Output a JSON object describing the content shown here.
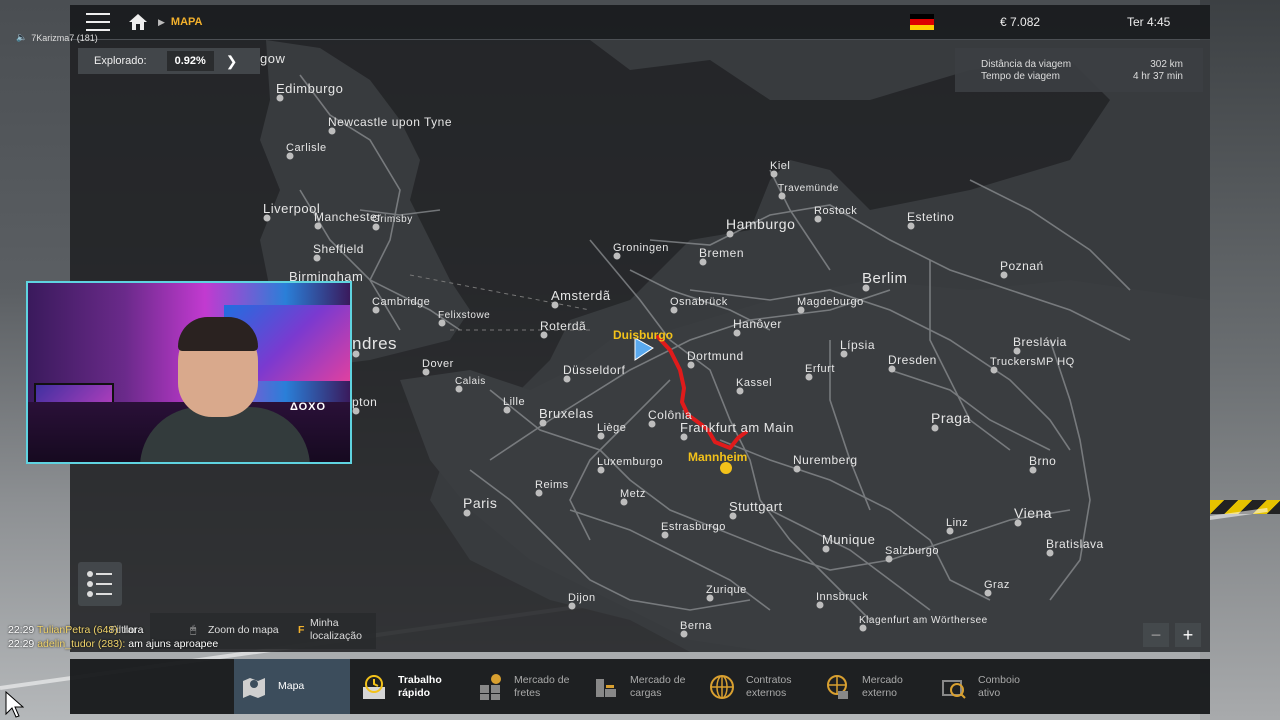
{
  "topbar": {
    "breadcrumb": "MAPA",
    "money": "€ 7.082",
    "clock": "Ter 4:45",
    "flag_colors": [
      "#000000",
      "#dd0000",
      "#ffce00"
    ]
  },
  "viewer": {
    "text": "7Karizma7 (181)"
  },
  "explored": {
    "label": "Explorado:",
    "value": "0.92%"
  },
  "trip": {
    "distance_label": "Distância da viagem",
    "distance_value": "302 km",
    "time_label": "Tempo de viagem",
    "time_value": "4 hr 37 min"
  },
  "cities": [
    {
      "name": "gow"
    },
    {
      "name": "Edimburgo"
    },
    {
      "name": "Newcastle upon Tyne"
    },
    {
      "name": "Carlisle"
    },
    {
      "name": "Liverpool"
    },
    {
      "name": "Manchester"
    },
    {
      "name": "Grimsby"
    },
    {
      "name": "Sheffield"
    },
    {
      "name": "Birmingham"
    },
    {
      "name": "Cambridge"
    },
    {
      "name": "Felixstowe"
    },
    {
      "name": "ndres"
    },
    {
      "name": "Dover"
    },
    {
      "name": "Calais"
    },
    {
      "name": "pton"
    },
    {
      "name": "Lille"
    },
    {
      "name": "Bruxelas"
    },
    {
      "name": "Liège"
    },
    {
      "name": "Paris"
    },
    {
      "name": "Reims"
    },
    {
      "name": "Luxemburgo"
    },
    {
      "name": "Metz"
    },
    {
      "name": "Estrasburgo"
    },
    {
      "name": "Dijon"
    },
    {
      "name": "Zurique"
    },
    {
      "name": "Berna"
    },
    {
      "name": "Amsterdã"
    },
    {
      "name": "Roterdã"
    },
    {
      "name": "Düsseldorf"
    },
    {
      "name": "Colônia"
    },
    {
      "name": "Groningen"
    },
    {
      "name": "Bremen"
    },
    {
      "name": "Hamburgo"
    },
    {
      "name": "Kiel"
    },
    {
      "name": "Travemünde"
    },
    {
      "name": "Rostock"
    },
    {
      "name": "Osnabrück"
    },
    {
      "name": "Dortmund"
    },
    {
      "name": "Hanôver"
    },
    {
      "name": "Kassel"
    },
    {
      "name": "Frankfurt am Main"
    },
    {
      "name": "Magdeburgo"
    },
    {
      "name": "Berlim"
    },
    {
      "name": "Lípsia"
    },
    {
      "name": "Erfurt"
    },
    {
      "name": "Dresden"
    },
    {
      "name": "Nuremberg"
    },
    {
      "name": "Stuttgart"
    },
    {
      "name": "Munique"
    },
    {
      "name": "Innsbruck"
    },
    {
      "name": "Salzburgo"
    },
    {
      "name": "Klagenfurt am Wörthersee"
    },
    {
      "name": "Linz"
    },
    {
      "name": "Graz"
    },
    {
      "name": "Viena"
    },
    {
      "name": "Bratislava"
    },
    {
      "name": "Brno"
    },
    {
      "name": "Praga"
    },
    {
      "name": "Estetino"
    },
    {
      "name": "Poznań"
    },
    {
      "name": "Breslávia"
    },
    {
      "name": "TruckersMP HQ"
    }
  ],
  "route": {
    "origin": "Duisburgo",
    "destination": "Mannheim",
    "route_color": "#e01b1b",
    "marker_color": "#f3c21a"
  },
  "chat": [
    {
      "time": "22:29",
      "user": "TulianPetra (648):",
      "text": "llora"
    },
    {
      "time": "22:29",
      "user": "adelin_tudor (283):",
      "text": "am ajuns aproapee"
    }
  ],
  "hints": {
    "filter": "Filtrar",
    "zoom": "Zoom do mapa",
    "key": "F",
    "location": "Minha\nlocalização"
  },
  "zoom": {
    "minus": "−",
    "plus": "+"
  },
  "tabs": [
    {
      "label": "Mapa",
      "icon": "map-icon"
    },
    {
      "label": "Trabalho\nrápido",
      "icon": "clock-icon"
    },
    {
      "label": "Mercado de\nfretes",
      "icon": "cargo-market-icon"
    },
    {
      "label": "Mercado de\ncargas",
      "icon": "freight-icon"
    },
    {
      "label": "Contratos\nexternos",
      "icon": "globe-contract-icon"
    },
    {
      "label": "Mercado\nexterno",
      "icon": "globe-market-icon"
    },
    {
      "label": "Comboio\nativo",
      "icon": "convoy-icon"
    }
  ],
  "webcam": {
    "logo": "ΔΟΧΟ"
  }
}
